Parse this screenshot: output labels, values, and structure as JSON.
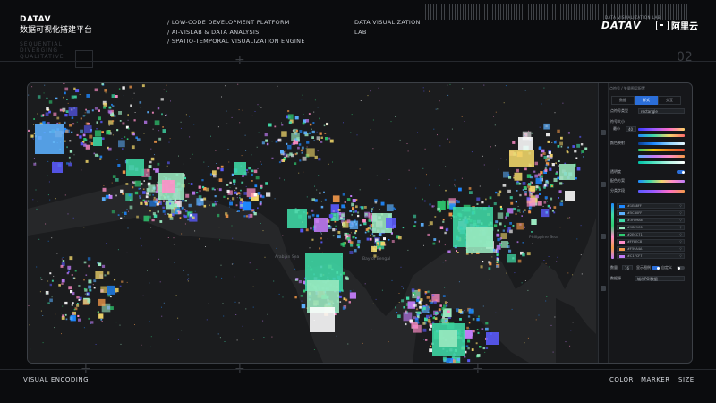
{
  "header": {
    "brand": "DATAV",
    "brand_cn": "数据可视化搭建平台",
    "ghost_lines": [
      "SEQUENTIAL",
      "DIVERGING",
      "QUALITATIVE"
    ],
    "links": [
      "/ LOW-CODE DEVELOPMENT PLATFORM",
      "/ AI-VISLAB & DATA ANALYSIS",
      "/ SPATIO-TEMPORAL VISUALIZATION ENGINE"
    ],
    "lab": [
      "DATA VISUALIZATION",
      "LAB"
    ],
    "datav_tagline": "DATA VISUALIZATION LAB",
    "datav_logo": "DATAV",
    "aliyun_logo": "阿里云",
    "section_number": "02"
  },
  "map": {
    "labels": [
      "Arabian Sea",
      "Bay of Bengal",
      "Philippine Sea"
    ],
    "palette": [
      "#5cb0ff",
      "#3fd9a6",
      "#9be9c0",
      "#f3d86b",
      "#ff8ec8",
      "#c17cf7",
      "#5b5bff",
      "#f59a4a",
      "#ffffff",
      "#1e88ff",
      "#2ecc71"
    ]
  },
  "panel": {
    "title": "点符号 / 矢量图层配置",
    "tabs": [
      "数据",
      "样式",
      "交互"
    ],
    "active_tab": 1,
    "side_icons": [
      "layers-icon",
      "style-icon",
      "filter-icon",
      "table-icon"
    ],
    "rows": {
      "shape_label": "点符号类型",
      "shape_value": "rectangle",
      "size_label": "符号大小",
      "size_min_label": "最小",
      "size_value": "40",
      "color_label": "颜色映射",
      "opacity_label": "透明度",
      "scheme_label": "配色方案",
      "field_label": "分类字段",
      "count_label": "数量",
      "count_value": "16",
      "legend_label": "显示图例",
      "custom_label": "自定义",
      "data_label": "数据源",
      "data_value": "城市POI数据"
    },
    "ramps": [
      [
        "#3b3bff",
        "#9b59ff",
        "#ff6ec7",
        "#ffd166"
      ],
      [
        "#1e88ff",
        "#3fd9a6",
        "#f3d86b",
        "#ff6b6b"
      ],
      [
        "#0b3d91",
        "#1e88ff",
        "#8fd3ff",
        "#e8f7ff"
      ],
      [
        "#2ecc71",
        "#f1c40f",
        "#e67e22",
        "#e74c3c"
      ],
      [
        "#5cb0ff",
        "#c17cf7",
        "#ff8ec8",
        "#f59a4a"
      ],
      [
        "#00c2a8",
        "#4fe3c1",
        "#b8f5e4",
        "#ffffff"
      ]
    ],
    "swatches": [
      {
        "color": "#1e88ff",
        "hex": "#1E88FF"
      },
      {
        "color": "#5cb0ff",
        "hex": "#5CB0FF"
      },
      {
        "color": "#3fd9a6",
        "hex": "#3FD9A6"
      },
      {
        "color": "#9be9c0",
        "hex": "#9BE9C0"
      },
      {
        "color": "#2ecc71",
        "hex": "#2ECC71"
      },
      {
        "color": "#ff8ec8",
        "hex": "#FF8EC8"
      },
      {
        "color": "#f59a4a",
        "hex": "#F59A4A"
      },
      {
        "color": "#c17cf7",
        "hex": "#C17CF7"
      }
    ]
  },
  "footer": {
    "left": "VISUAL ENCODING",
    "right": [
      "COLOR",
      "MARKER",
      "SIZE"
    ]
  }
}
